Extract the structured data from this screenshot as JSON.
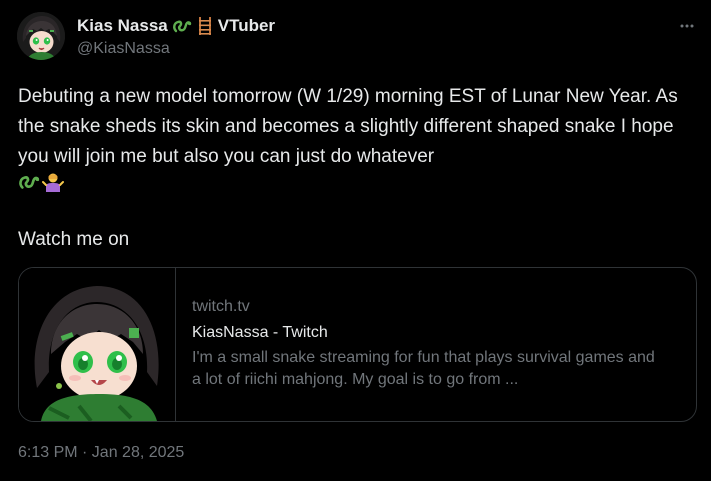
{
  "author": {
    "display_name": "Kias Nassa",
    "name_suffix": "VTuber",
    "handle": "@KiasNassa",
    "name_icons": [
      "snake-icon",
      "ladder-icon"
    ]
  },
  "tweet": {
    "text": "Debuting a new model tomorrow (W 1/29) morning EST of Lunar New Year. As the snake sheds its skin and becomes a slightly different shaped snake I hope you will join me but also you can just do whatever",
    "emoji_line_icons": [
      "snake-icon",
      "person-shrugging-icon"
    ],
    "watch_text": "Watch me on"
  },
  "card": {
    "domain": "twitch.tv",
    "title": "KiasNassa - Twitch",
    "description": "I'm a small snake streaming for fun that plays survival games and a lot of riichi mahjong. My goal is to go from ..."
  },
  "timestamp": "6:13 PM · Jan 28, 2025",
  "colors": {
    "background": "#000000",
    "text": "#e7e9ea",
    "secondary": "#71767b",
    "border": "#2f3336"
  }
}
